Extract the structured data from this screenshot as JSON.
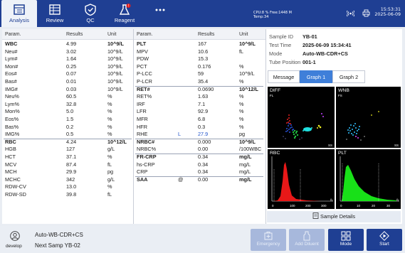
{
  "tabs": [
    {
      "label": "Analysis",
      "icon": "analysis-icon",
      "active": true
    },
    {
      "label": "Review",
      "icon": "review-icon"
    },
    {
      "label": "QC",
      "icon": "qc-icon"
    },
    {
      "label": "Reagent",
      "icon": "reagent-icon",
      "badge": "!"
    }
  ],
  "more_icon": "more-icon",
  "sysinfo": {
    "line1": "CPU:8 % Free:1448 M",
    "line2": "Temp:34"
  },
  "clock": {
    "time": "15:53:31",
    "date": "2025-06-09"
  },
  "headers": {
    "param": "Param.",
    "results": "Results",
    "unit": "Unit"
  },
  "left_rows": [
    {
      "param": "WBC",
      "result": "4.99",
      "unit": "10^9/L",
      "bold": true
    },
    {
      "param": "Neu#",
      "result": "3.02",
      "unit": "10^9/L"
    },
    {
      "param": "Lym#",
      "result": "1.64",
      "unit": "10^9/L"
    },
    {
      "param": "Mon#",
      "result": "0.25",
      "unit": "10^9/L"
    },
    {
      "param": "Eos#",
      "result": "0.07",
      "unit": "10^9/L"
    },
    {
      "param": "Bas#",
      "result": "0.01",
      "unit": "10^9/L"
    },
    {
      "param": "IMG#",
      "result": "0.03",
      "unit": "10^9/L"
    },
    {
      "param": "Neu%",
      "result": "60.5",
      "unit": "%"
    },
    {
      "param": "Lym%",
      "result": "32.8",
      "unit": "%"
    },
    {
      "param": "Mon%",
      "result": "5.0",
      "unit": "%"
    },
    {
      "param": "Eos%",
      "result": "1.5",
      "unit": "%"
    },
    {
      "param": "Bas%",
      "result": "0.2",
      "unit": "%"
    },
    {
      "param": "IMG%",
      "result": "0.5",
      "unit": "%"
    },
    {
      "param": "RBC",
      "result": "4.24",
      "unit": "10^12/L",
      "bold": true
    },
    {
      "param": "HGB",
      "result": "127",
      "unit": "g/L"
    },
    {
      "param": "HCT",
      "result": "37.1",
      "unit": "%"
    },
    {
      "param": "MCV",
      "result": "87.4",
      "unit": "fL"
    },
    {
      "param": "MCH",
      "result": "29.9",
      "unit": "pg"
    },
    {
      "param": "MCHC",
      "result": "342",
      "unit": "g/L"
    },
    {
      "param": "RDW-CV",
      "result": "13.0",
      "unit": "%"
    },
    {
      "param": "RDW-SD",
      "result": "39.8",
      "unit": "fL"
    }
  ],
  "mid_rows": [
    {
      "param": "PLT",
      "result": "167",
      "unit": "10^9/L",
      "bold": true
    },
    {
      "param": "MPV",
      "result": "10.6",
      "unit": "fL"
    },
    {
      "param": "PDW",
      "result": "15.3",
      "unit": ""
    },
    {
      "param": "PCT",
      "result": "0.176",
      "unit": "%"
    },
    {
      "param": "P-LCC",
      "result": "59",
      "unit": "10^9/L"
    },
    {
      "param": "P-LCR",
      "result": "35.4",
      "unit": "%"
    },
    {
      "param": "RET#",
      "result": "0.0690",
      "unit": "10^12/L",
      "bold": true
    },
    {
      "param": "RET%",
      "result": "1.63",
      "unit": "%"
    },
    {
      "param": "IRF",
      "result": "7.1",
      "unit": "%"
    },
    {
      "param": "LFR",
      "result": "92.9",
      "unit": "%"
    },
    {
      "param": "MFR",
      "result": "6.8",
      "unit": "%"
    },
    {
      "param": "HFR",
      "result": "0.3",
      "unit": "%"
    },
    {
      "param": "RHE",
      "flag": "L",
      "result": "27.9",
      "unit": "pg",
      "blue": true
    },
    {
      "param": "NRBC#",
      "result": "0.000",
      "unit": "10^9/L",
      "bold": true
    },
    {
      "param": "NRBC%",
      "result": "0.00",
      "unit": "/100WBC"
    },
    {
      "param": "FR-CRP",
      "result": "0.34",
      "unit": "mg/L",
      "bold": true
    },
    {
      "param": "hs-CRP",
      "result": "0.34",
      "unit": "mg/L"
    },
    {
      "param": "CRP",
      "result": "0.34",
      "unit": "mg/L"
    },
    {
      "param": "SAA",
      "flag": "@",
      "result": "0.00",
      "unit": "mg/L",
      "bold": true
    }
  ],
  "sample": {
    "id_label": "Sample ID",
    "id": "YB-01",
    "time_label": "Test Time",
    "time": "2025-06-09 15:34:41",
    "mode_label": "Mode",
    "mode": "Auto-WB-CDR+CS",
    "tube_label": "Tube Position",
    "tube": "001-1"
  },
  "graph_tabs": [
    "Message",
    "Graph 1",
    "Graph 2"
  ],
  "plots": {
    "diff": {
      "title": "DIFF",
      "sub": "FL",
      "axis": "SS"
    },
    "wnb": {
      "title": "WNB",
      "sub": "FS",
      "axis": "SS"
    },
    "rbc": {
      "title": "RBC",
      "ticks": [
        "0",
        "100",
        "200",
        "300"
      ],
      "unit": "fL"
    },
    "plt": {
      "title": "PLT",
      "ticks": [
        "0",
        "10",
        "20",
        "30"
      ],
      "unit": "fL"
    }
  },
  "sample_details": "Sample Details",
  "user": {
    "name": "develop",
    "icon": "user-icon"
  },
  "status": {
    "mode": "Auto-WB-CDR+CS",
    "next": "Next Samp YB-02"
  },
  "buttons": [
    {
      "label": "Emergency",
      "icon": "emergency-icon",
      "enabled": false
    },
    {
      "label": "Add Diluent",
      "icon": "add-diluent-icon",
      "enabled": false
    },
    {
      "label": "Mode",
      "icon": "mode-icon",
      "enabled": true
    },
    {
      "label": "Start",
      "icon": "start-icon",
      "enabled": true
    }
  ],
  "colors": {
    "primary": "#1f3f93",
    "accent": "#3f7fd9",
    "flag": "#2255cc"
  }
}
